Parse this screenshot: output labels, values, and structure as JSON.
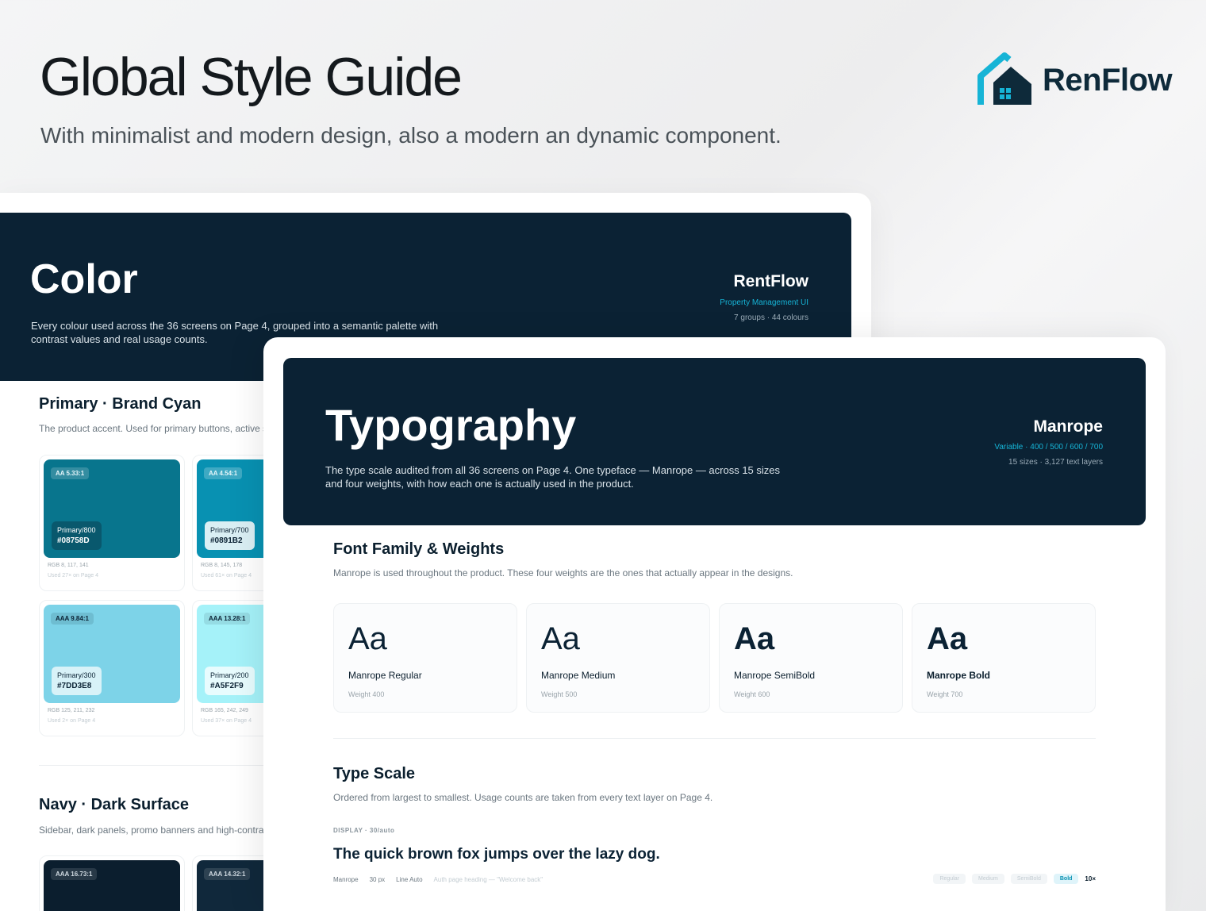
{
  "header": {
    "title": "Global Style Guide",
    "subtitle": "With minimalist and modern design, also a modern an dynamic component.",
    "logo_text": "RenFlow"
  },
  "color": {
    "title": "Color",
    "description": "Every colour used across the 36 screens on Page 4, grouped into a semantic palette with contrast values and real usage counts.",
    "brand_name": "RentFlow",
    "brand_tag": "Property Management UI",
    "brand_meta": "7 groups · 44 colours",
    "primary": {
      "heading": "Primary · Brand Cyan",
      "description": "The product accent. Used for primary buttons, active s",
      "swatches": [
        {
          "badge": "AA 5.33:1",
          "name": "Primary/800",
          "hex": "#08758D",
          "rgb": "RGB 8, 117, 141",
          "used": "Used 27× on Page 4",
          "color": "#08758D"
        },
        {
          "badge": "AA 4.54:1",
          "name": "Primary/700",
          "hex": "#0891B2",
          "rgb": "RGB 8, 145, 178",
          "used": "Used 61× on Page 4",
          "color": "#0891B2"
        },
        {
          "badge": "AAA 9.84:1",
          "name": "Primary/300",
          "hex": "#7DD3E8",
          "rgb": "RGB 125, 211, 232",
          "used": "Used 2× on Page 4",
          "color": "#7DD3E8"
        },
        {
          "badge": "AAA 13.28:1",
          "name": "Primary/200",
          "hex": "#A5F2F9",
          "rgb": "RGB 165, 242, 249",
          "used": "Used 37× on Page 4",
          "color": "#A5F2F9"
        }
      ]
    },
    "navy": {
      "heading": "Navy · Dark Surface",
      "description": "Sidebar, dark panels, promo banners and high-contras",
      "swatches": [
        {
          "badge": "AAA 16.73:1",
          "color": "#0B1E2E"
        },
        {
          "badge": "AAA 14.32:1",
          "color": "#10283B"
        }
      ]
    }
  },
  "typography": {
    "title": "Typography",
    "description": "The type scale audited from all 36 screens on Page 4. One typeface — Manrope — across 15 sizes and four weights, with how each one is actually used in the product.",
    "font_name": "Manrope",
    "font_tag": "Variable · 400 / 500 / 600 / 700",
    "font_meta": "15 sizes · 3,127 text layers",
    "family": {
      "heading": "Font Family & Weights",
      "description": "Manrope is used throughout the product. These four weights are the ones that actually appear in the designs.",
      "weights": [
        {
          "sample": "Aa",
          "name": "Manrope Regular",
          "weight": "Weight 400"
        },
        {
          "sample": "Aa",
          "name": "Manrope Medium",
          "weight": "Weight 500"
        },
        {
          "sample": "Aa",
          "name": "Manrope SemiBold",
          "weight": "Weight 600"
        },
        {
          "sample": "Aa",
          "name": "Manrope Bold",
          "weight": "Weight 700"
        }
      ]
    },
    "scale": {
      "heading": "Type Scale",
      "description": "Ordered from largest to smallest. Usage counts are taken from every text layer on Page 4.",
      "kicker": "DISPLAY · 30/auto",
      "sample": "The quick brown fox jumps over the lazy dog.",
      "meta": {
        "family": "Manrope",
        "size": "30 px",
        "line": "Line Auto",
        "usage": "Auth page heading — \"Welcome back\""
      },
      "chips": [
        "Regular",
        "Medium",
        "SemiBold",
        "Bold"
      ],
      "count": "10×"
    }
  }
}
